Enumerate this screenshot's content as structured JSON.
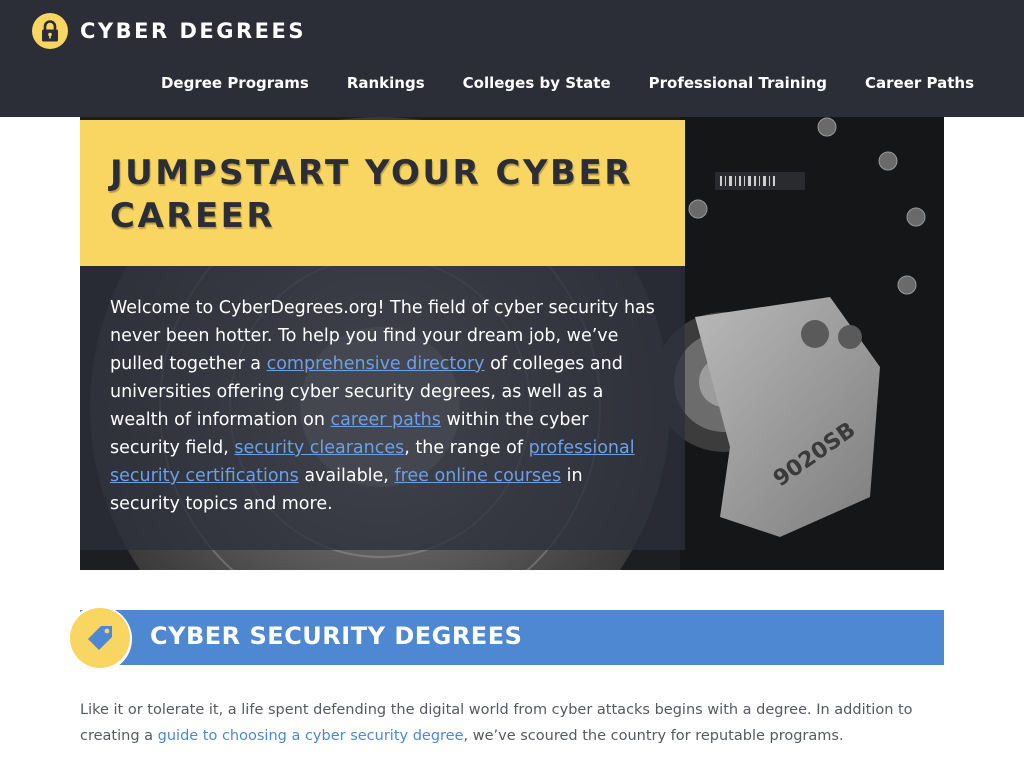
{
  "brand": {
    "name": "CYBER DEGREES",
    "logo_icon": "padlock-icon",
    "logo_color": "#f9d562"
  },
  "nav": {
    "items": [
      {
        "label": "Degree Programs"
      },
      {
        "label": "Rankings"
      },
      {
        "label": "Colleges by State"
      },
      {
        "label": "Professional Training"
      },
      {
        "label": "Career Paths"
      }
    ]
  },
  "hero": {
    "title": "JUMPSTART YOUR CYBER CAREER",
    "body": {
      "t1": "Welcome to CyberDegrees.org! The field of cyber security has never been hotter. To help you find your dream job, we’ve pulled together a ",
      "link_directory": "comprehensive directory",
      "t2": " of colleges and universities offering cyber security degrees, as well as a wealth of information on ",
      "link_career_paths": "career paths",
      "t3": " within the cyber security field, ",
      "link_clearances": "security clearances",
      "t4": ", the range of ",
      "link_certifications": "professional security certifications",
      "t5": " available, ",
      "link_courses": "free online courses",
      "t6": " in security topics and more."
    },
    "image_label": "9020SB"
  },
  "section": {
    "icon": "tag-icon",
    "title": "CYBER SECURITY DEGREES",
    "text1": "Like it or tolerate it, a life spent defending the digital world from cyber attacks begins with a degree. In addition to creating a ",
    "link_guide": "guide to choosing a cyber security degree",
    "text2": ", we’ve scoured the country for reputable programs."
  },
  "colors": {
    "header_bg": "#2b2e36",
    "accent_yellow": "#f9d562",
    "accent_blue": "#4e88d2",
    "link_blue": "#6f9fe6"
  }
}
